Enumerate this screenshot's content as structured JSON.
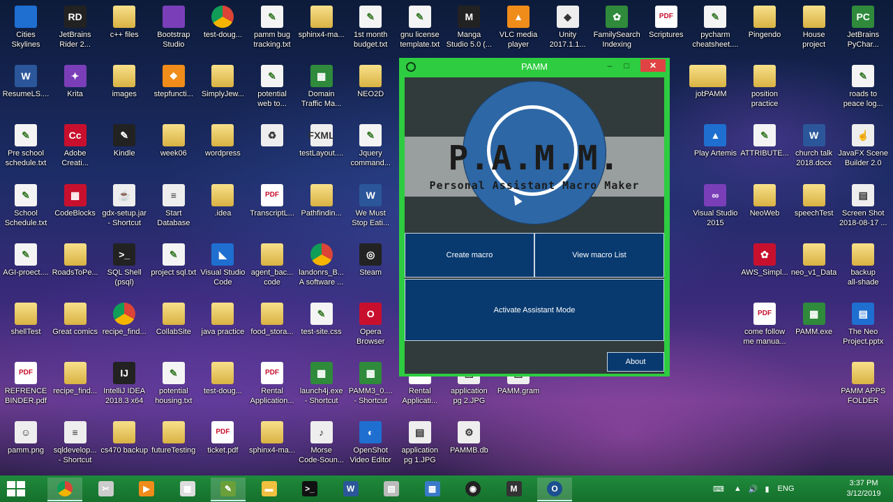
{
  "desktop_icons": [
    {
      "label": "Cities\nSkylines",
      "type": "ic-blue",
      "glyph": ""
    },
    {
      "label": "JetBrains\nRider 2...",
      "type": "ic-dark",
      "glyph": "RD"
    },
    {
      "label": "c++ files",
      "type": "ic-folder",
      "glyph": ""
    },
    {
      "label": "Bootstrap\nStudio",
      "type": "ic-purple",
      "glyph": ""
    },
    {
      "label": "test-doug...",
      "type": "ic-chrome",
      "glyph": ""
    },
    {
      "label": "pamm bug\ntracking.txt",
      "type": "ic-txt",
      "glyph": "✎"
    },
    {
      "label": "sphinx4-ma...",
      "type": "ic-folder",
      "glyph": ""
    },
    {
      "label": "1st month\nbudget.txt",
      "type": "ic-txt",
      "glyph": "✎"
    },
    {
      "label": "gnu license\ntemplate.txt",
      "type": "ic-txt",
      "glyph": "✎"
    },
    {
      "label": "Manga\nStudio 5.0 (...",
      "type": "ic-dark",
      "glyph": "M"
    },
    {
      "label": "VLC media\nplayer",
      "type": "ic-orange",
      "glyph": "▲"
    },
    {
      "label": "Unity\n2017.1.1...",
      "type": "ic-white",
      "glyph": "◆"
    },
    {
      "label": "FamilySearch\nIndexing",
      "type": "ic-green",
      "glyph": "✿"
    },
    {
      "label": "Scriptures",
      "type": "ic-pdf",
      "glyph": "PDF"
    },
    {
      "label": "pycharm\ncheatsheet....",
      "type": "ic-txt",
      "glyph": "✎"
    },
    {
      "label": "Pingendo",
      "type": "ic-folder",
      "glyph": ""
    },
    {
      "label": "House\nproject",
      "type": "ic-folder",
      "glyph": ""
    },
    {
      "label": "JetBrains\nPyChar...",
      "type": "ic-green",
      "glyph": "PC"
    },
    {
      "label": "ResumeLS....",
      "type": "ic-word",
      "glyph": "W"
    },
    {
      "label": "Krita",
      "type": "ic-purple",
      "glyph": "✦"
    },
    {
      "label": "images",
      "type": "ic-folder",
      "glyph": ""
    },
    {
      "label": "stepfuncti...",
      "type": "ic-orange",
      "glyph": "❖"
    },
    {
      "label": "SimplyJew...",
      "type": "ic-folder",
      "glyph": ""
    },
    {
      "label": "potential\nweb to...",
      "type": "ic-txt",
      "glyph": "✎"
    },
    {
      "label": "Domain\nTraffic Ma...",
      "type": "ic-green",
      "glyph": "▦"
    },
    {
      "label": "NEO2D",
      "type": "ic-folder",
      "glyph": ""
    },
    {
      "label": "job",
      "type": "ic-folder",
      "glyph": ""
    },
    {
      "label": "PAMM",
      "type": "ic-folder",
      "glyph": ""
    },
    {
      "label": "position\npractice",
      "type": "ic-folder",
      "glyph": ""
    },
    {
      "label": "roads to\npeace log...",
      "type": "ic-txt",
      "glyph": "✎"
    },
    {
      "label": "Pre school\nschedule.txt",
      "type": "ic-txt",
      "glyph": "✎"
    },
    {
      "label": "Adobe\nCreati...",
      "type": "ic-red",
      "glyph": "Cc"
    },
    {
      "label": "Kindle",
      "type": "ic-dark",
      "glyph": "✎"
    },
    {
      "label": "week06",
      "type": "ic-folder",
      "glyph": ""
    },
    {
      "label": "wordpress",
      "type": "ic-folder",
      "glyph": ""
    },
    {
      "label": "",
      "type": "ic-white",
      "glyph": "♻"
    },
    {
      "label": "testLayout....",
      "type": "ic-white",
      "glyph": "FXML"
    },
    {
      "label": "Jquery\ncommand...",
      "type": "ic-txt",
      "glyph": "✎"
    },
    {
      "label": "Play Artemis",
      "type": "ic-blue",
      "glyph": "▲"
    },
    {
      "label": "ATTRIBUTE...",
      "type": "ic-txt",
      "glyph": "✎"
    },
    {
      "label": "church talk\n2018.docx",
      "type": "ic-word",
      "glyph": "W"
    },
    {
      "label": "JavaFX Scene\nBuilder 2.0",
      "type": "ic-white",
      "glyph": "☝"
    },
    {
      "label": "School\nSchedule.txt",
      "type": "ic-txt",
      "glyph": "✎"
    },
    {
      "label": "CodeBlocks",
      "type": "ic-red",
      "glyph": "▦"
    },
    {
      "label": "gdx-setup.jar\n- Shortcut",
      "type": "ic-white",
      "glyph": "☕"
    },
    {
      "label": "Start\nDatabase",
      "type": "ic-white",
      "glyph": "≡"
    },
    {
      "label": ".idea",
      "type": "ic-folder",
      "glyph": ""
    },
    {
      "label": "TranscriptL...",
      "type": "ic-pdf",
      "glyph": "PDF"
    },
    {
      "label": "Pathfindin...",
      "type": "ic-folder",
      "glyph": ""
    },
    {
      "label": "We Must\nStop Eati...",
      "type": "ic-word",
      "glyph": "W"
    },
    {
      "label": "Visual Studio\n2015",
      "type": "ic-purple",
      "glyph": "∞"
    },
    {
      "label": "NeoWeb",
      "type": "ic-folder",
      "glyph": ""
    },
    {
      "label": "speechTest",
      "type": "ic-folder",
      "glyph": ""
    },
    {
      "label": "Screen Shot\n2018-08-17 ...",
      "type": "ic-white",
      "glyph": "▤"
    },
    {
      "label": "AGI-proect....",
      "type": "ic-txt",
      "glyph": "✎"
    },
    {
      "label": "RoadsToPe...",
      "type": "ic-folder",
      "glyph": ""
    },
    {
      "label": "SQL Shell\n(psql)",
      "type": "ic-dark",
      "glyph": ">_"
    },
    {
      "label": "project sql.txt",
      "type": "ic-txt",
      "glyph": "✎"
    },
    {
      "label": "Visual Studio\nCode",
      "type": "ic-blue",
      "glyph": "◣"
    },
    {
      "label": "agent_bac...\ncode",
      "type": "ic-folder",
      "glyph": ""
    },
    {
      "label": "landonrs_B...\nA software ...",
      "type": "ic-chrome",
      "glyph": ""
    },
    {
      "label": "Steam",
      "type": "ic-dark",
      "glyph": "◎"
    },
    {
      "label": "AWS_Simpl...",
      "type": "ic-red",
      "glyph": "✿"
    },
    {
      "label": "neo_v1_Data",
      "type": "ic-folder",
      "glyph": ""
    },
    {
      "label": "backup\nall-shade",
      "type": "ic-folder",
      "glyph": ""
    },
    {
      "label": "shellTest",
      "type": "ic-folder",
      "glyph": ""
    },
    {
      "label": "Great comics",
      "type": "ic-folder",
      "glyph": ""
    },
    {
      "label": "recipe_find...",
      "type": "ic-chrome",
      "glyph": ""
    },
    {
      "label": "CollabSite",
      "type": "ic-folder",
      "glyph": ""
    },
    {
      "label": "java practice",
      "type": "ic-folder",
      "glyph": ""
    },
    {
      "label": "food_stora...",
      "type": "ic-folder",
      "glyph": ""
    },
    {
      "label": "test-site.css",
      "type": "ic-txt",
      "glyph": "✎"
    },
    {
      "label": "Opera\nBrowser",
      "type": "ic-red",
      "glyph": "O"
    },
    {
      "label": "come follow\nme manua...",
      "type": "ic-pdf",
      "glyph": "PDF"
    },
    {
      "label": "PAMM.exe",
      "type": "ic-green",
      "glyph": "▦"
    },
    {
      "label": "The Neo\nProject.pptx",
      "type": "ic-blue",
      "glyph": "▤"
    },
    {
      "label": "REFRENCE\nBINDER.pdf",
      "type": "ic-pdf",
      "glyph": "PDF"
    },
    {
      "label": "recipe_find...",
      "type": "ic-folder",
      "glyph": ""
    },
    {
      "label": "IntelliJ IDEA\n2018.3 x64",
      "type": "ic-dark",
      "glyph": "IJ"
    },
    {
      "label": "potential\nhousing.txt",
      "type": "ic-txt",
      "glyph": "✎"
    },
    {
      "label": "test-doug...",
      "type": "ic-folder",
      "glyph": ""
    },
    {
      "label": "Rental\nApplication...",
      "type": "ic-pdf",
      "glyph": "PDF"
    },
    {
      "label": "launch4j.exe\n- Shortcut",
      "type": "ic-green",
      "glyph": "▦"
    },
    {
      "label": "PAMM3_0....\n- Shortcut",
      "type": "ic-green",
      "glyph": "▦"
    },
    {
      "label": "Rental\nApplicati...",
      "type": "ic-pdf",
      "glyph": "PDF"
    },
    {
      "label": "application\npg 2.JPG",
      "type": "ic-white",
      "glyph": "▤"
    },
    {
      "label": "PAMM.gram",
      "type": "ic-white",
      "glyph": "▤"
    },
    {
      "label": "PAMM APPS\nFOLDER",
      "type": "ic-folder",
      "glyph": ""
    },
    {
      "label": "pamm.png",
      "type": "ic-white",
      "glyph": "☺"
    },
    {
      "label": "sqldevelop...\n- Shortcut",
      "type": "ic-white",
      "glyph": "≡"
    },
    {
      "label": "cs470 backup",
      "type": "ic-folder",
      "glyph": ""
    },
    {
      "label": "futureTesting",
      "type": "ic-folder",
      "glyph": ""
    },
    {
      "label": "ticket.pdf",
      "type": "ic-pdf",
      "glyph": "PDF"
    },
    {
      "label": "sphinx4-ma...",
      "type": "ic-folder",
      "glyph": ""
    },
    {
      "label": "Morse\nCode-Soun...",
      "type": "ic-white",
      "glyph": "♪"
    },
    {
      "label": "OpenShot\nVideo Editor",
      "type": "ic-blue",
      "glyph": "◐"
    },
    {
      "label": "application\npg 1.JPG",
      "type": "ic-white",
      "glyph": "▤"
    },
    {
      "label": "PAMMB.db",
      "type": "ic-white",
      "glyph": "⚙"
    }
  ],
  "pamm_window": {
    "title": "PAMM",
    "min_glyph": "–",
    "max_glyph": "□",
    "close_glyph": "✕",
    "logo_title": "P.A.M.M.",
    "logo_subtitle": "Personal Assistant Macro Maker",
    "create_macro": "Create macro",
    "view_macro_list": "View macro List",
    "activate_assistant": "Activate Assistant Mode",
    "about": "About"
  },
  "taskbar": {
    "apps": [
      {
        "name": "chrome",
        "glyph": "",
        "active": true
      },
      {
        "name": "snipping",
        "glyph": "✂",
        "active": false
      },
      {
        "name": "media",
        "glyph": "▶",
        "active": false
      },
      {
        "name": "calculator",
        "glyph": "▦",
        "active": false
      },
      {
        "name": "notepad",
        "glyph": "✎",
        "active": true
      },
      {
        "name": "explorer",
        "glyph": "▬",
        "active": false
      },
      {
        "name": "cmd",
        "glyph": ">_",
        "active": false
      },
      {
        "name": "word",
        "glyph": "W",
        "active": false
      },
      {
        "name": "photos",
        "glyph": "▤",
        "active": false
      },
      {
        "name": "control-panel",
        "glyph": "▦",
        "active": false
      },
      {
        "name": "obs",
        "glyph": "◉",
        "active": false
      },
      {
        "name": "manga-studio",
        "glyph": "M",
        "active": false
      },
      {
        "name": "pamm",
        "glyph": "O",
        "active": true
      }
    ],
    "language": "ENG",
    "time": "3:37 PM",
    "date": "3/12/2019"
  }
}
